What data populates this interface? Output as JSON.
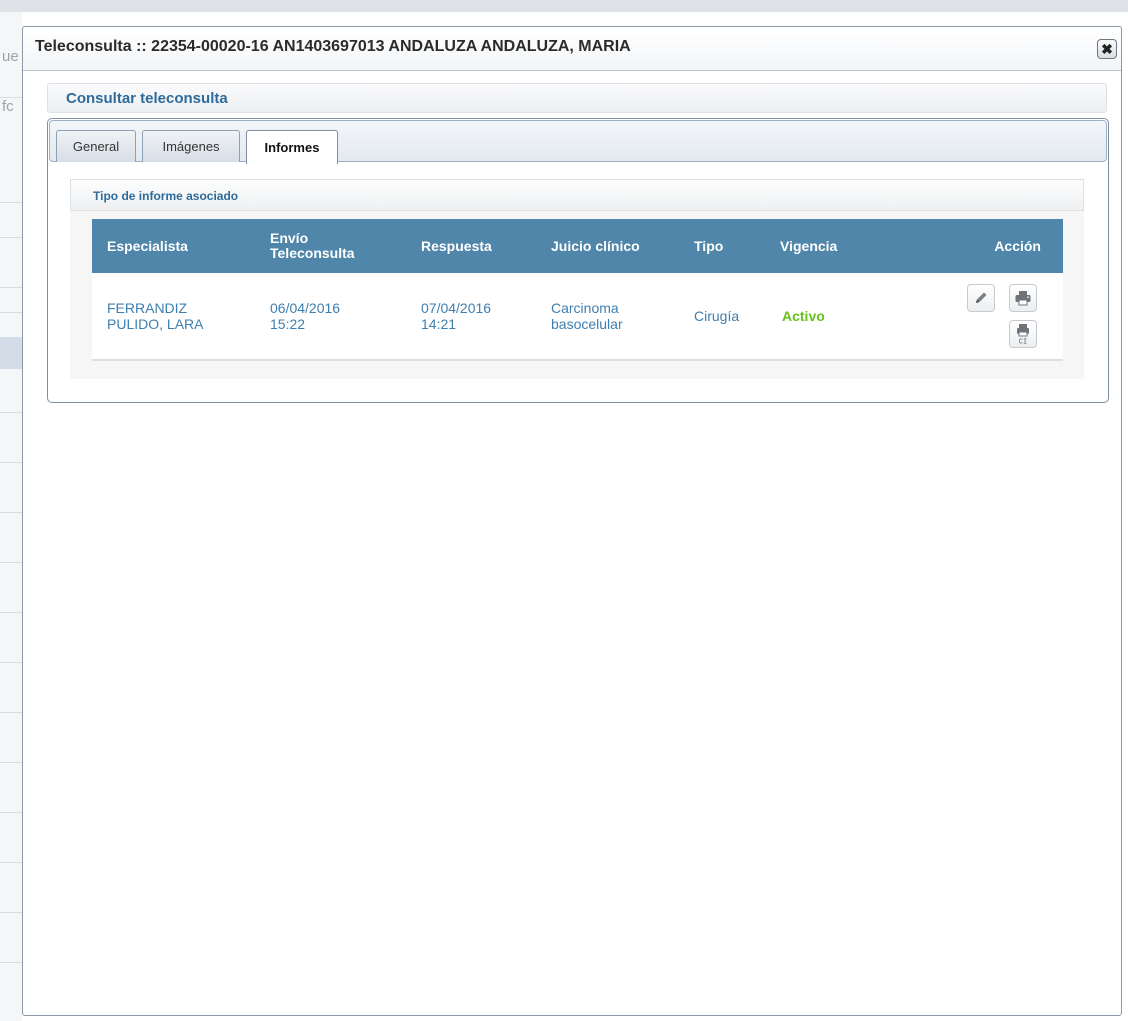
{
  "background": {
    "fragment_1": "ue",
    "fragment_2": "fc"
  },
  "modal": {
    "title": "Teleconsulta :: 22354-00020-16 AN1403697013 ANDALUZA ANDALUZA, MARIA",
    "close_icon": "close-icon"
  },
  "section": {
    "title": "Consultar teleconsulta"
  },
  "tabs": [
    {
      "label": "General",
      "active": false
    },
    {
      "label": "Imágenes",
      "active": false
    },
    {
      "label": "Informes",
      "active": true
    }
  ],
  "report": {
    "header": "Tipo de informe asociado",
    "columns": {
      "especialista": "Especialista",
      "envio_line1": "Envío",
      "envio_line2": "Teleconsulta",
      "respuesta": "Respuesta",
      "juicio": "Juicio clínico",
      "tipo": "Tipo",
      "vigencia": "Vigencia",
      "accion": "Acción"
    },
    "rows": [
      {
        "especialista_line1": "FERRANDIZ",
        "especialista_line2": "PULIDO, LARA",
        "envio_date": "06/04/2016",
        "envio_time": "15:22",
        "respuesta_date": "07/04/2016",
        "respuesta_time": "14:21",
        "juicio_line1": "Carcinoma",
        "juicio_line2": "basocelular",
        "tipo": "Cirugía",
        "vigencia": "Activo",
        "actions": [
          "edit-icon",
          "print-icon",
          "print-ci-icon"
        ],
        "ci_label": "CI"
      }
    ]
  },
  "colors": {
    "accent": "#2e6b9a",
    "header_bg": "#4f86a9",
    "cell_text": "#3d7fb0",
    "active_status": "#66c21a"
  }
}
